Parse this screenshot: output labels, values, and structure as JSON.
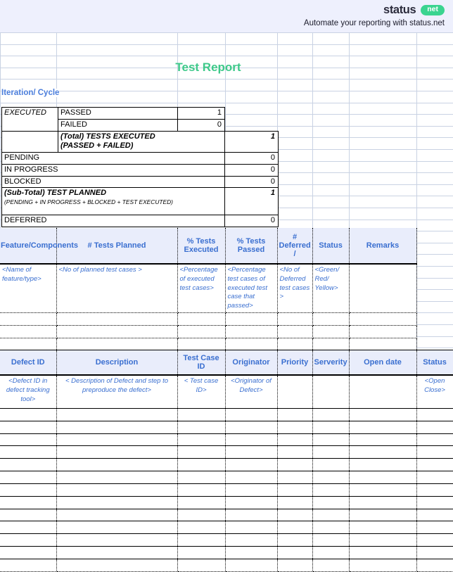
{
  "header": {
    "brand_word": "status",
    "brand_badge": "net",
    "tagline": "Automate your reporting with status.net",
    "band_color": "#eef0fd",
    "badge_color": "#3ad490"
  },
  "title": "Test Report",
  "title_color": "#3ec98a",
  "iteration_label": "Iteration/ Cycle",
  "executed_summary": {
    "group_label": "EXECUTED",
    "rows": [
      {
        "label": "PASSED",
        "value": "1"
      },
      {
        "label": "FAILED",
        "value": "0"
      }
    ],
    "total_executed_label": "(Total) TESTS EXECUTED",
    "total_executed_sub": "(PASSED + FAILED)",
    "total_executed_value": "1",
    "status_rows": [
      {
        "label": "PENDING",
        "value": "0"
      },
      {
        "label": "IN PROGRESS",
        "value": "0"
      },
      {
        "label": "BLOCKED",
        "value": "0"
      }
    ],
    "subtotal_label": "(Sub-Total) TEST PLANNED",
    "subtotal_sub": "(PENDING + IN PROGRESS + BLOCKED + TEST  EXECUTED)",
    "subtotal_value": "1",
    "deferred_label": "DEFERRED",
    "deferred_value": "0"
  },
  "feature_table": {
    "headers": [
      "Feature/Components",
      "# Tests Planned",
      "% Tests Executed",
      "% Tests Passed",
      "# Deferred /",
      "Status",
      "Remarks"
    ],
    "placeholder_row": [
      "<Name of feature/type>",
      "<No of  planned test cases >",
      "<Percentage of executed test cases>",
      "<Percentage test cases of executed test case that passed>",
      "<No of Deferred test cases >",
      "<Green/ Red/ Yellow>",
      ""
    ],
    "empty_rows": 3
  },
  "defect_table": {
    "headers": [
      "Defect ID",
      "Description",
      "Test Case ID",
      "Originator",
      "Priority",
      "Serverity",
      "Open date",
      "Status"
    ],
    "placeholder_row": [
      "<Defect ID in defect tracking tool>",
      "< Description of Defect and step to preproduce the defect>",
      "< Test case ID>",
      "<Originator of Defect>",
      "",
      "",
      "",
      "<Open Close>"
    ],
    "empty_rows": 13
  }
}
